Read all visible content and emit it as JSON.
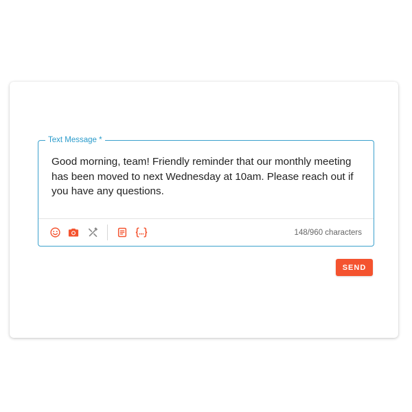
{
  "composer": {
    "label": "Text Message *",
    "message": "Good morning, team! Friendly reminder that our monthly meeting has been moved to next Wednesday at 10am. Please reach out if you have any questions.",
    "char_count": "148/960 characters",
    "send_label": "SEND"
  },
  "toolbar": {
    "tools": [
      {
        "name": "emoji-icon",
        "color": "#f4532f"
      },
      {
        "name": "camera-icon",
        "color": "#f4532f"
      },
      {
        "name": "link-disabled-icon",
        "color": "#8a8a8a"
      },
      {
        "name": "template-icon",
        "color": "#f4532f"
      },
      {
        "name": "variable-braces-icon",
        "color": "#f4532f"
      }
    ]
  },
  "colors": {
    "accent": "#f4532f",
    "field_border": "#3aa0cc",
    "label": "#2a9bcb"
  }
}
